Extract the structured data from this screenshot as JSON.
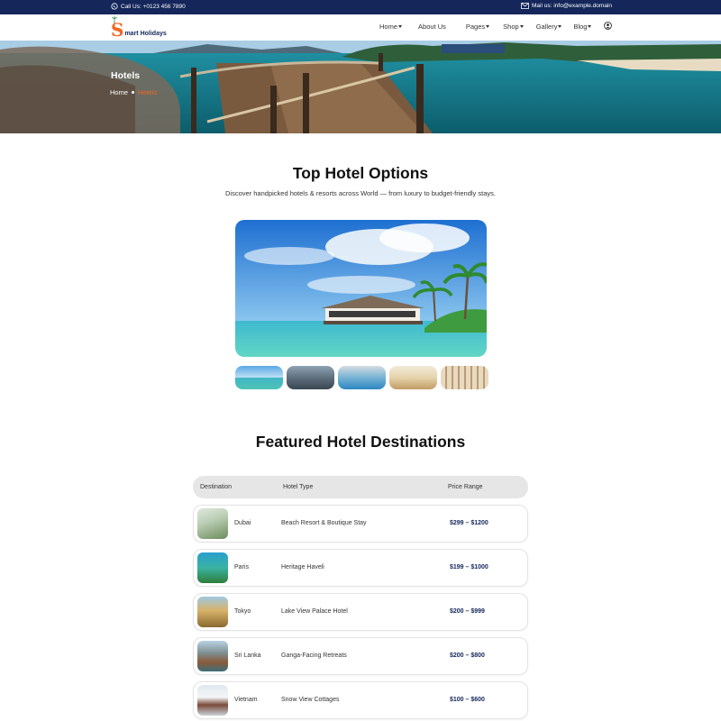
{
  "topbar": {
    "call": "Call Us: +0123 456 7890",
    "mail": "Mail us: info@example.domain"
  },
  "brand": {
    "logo_letter": "S",
    "logo_text": "mart Holidays",
    "accent": "#f26722",
    "navy": "#14265a"
  },
  "nav": [
    {
      "label": "Home",
      "dropdown": true
    },
    {
      "label": "About Us",
      "dropdown": false
    },
    {
      "label": "Pages",
      "dropdown": true
    },
    {
      "label": "Shop",
      "dropdown": true
    },
    {
      "label": "Gallery",
      "dropdown": true
    },
    {
      "label": "Blog",
      "dropdown": true
    }
  ],
  "hero": {
    "title": "Hotels",
    "breadcrumb_home": "Home",
    "breadcrumb_current": "Hotels"
  },
  "section1": {
    "title": "Top Hotel Options",
    "subtitle": "Discover handpicked hotels & resorts across World — from luxury to budget-friendly stays."
  },
  "section2": {
    "title": "Featured Hotel Destinations"
  },
  "table": {
    "headers": {
      "destination": "Destination",
      "type": "Hotel Type",
      "price": "Price Range"
    },
    "rows": [
      {
        "destination": "Dubai",
        "type": "Beach Resort & Boutique Stay",
        "price": "$299 – $1200"
      },
      {
        "destination": "Paris",
        "type": "Heritage Haveli",
        "price": "$199 – $1000"
      },
      {
        "destination": "Tokyo",
        "type": "Lake View Palace Hotel",
        "price": "$200 – $999"
      },
      {
        "destination": "Sri Lanka",
        "type": "Ganga-Facing Retreats",
        "price": "$200 – $800"
      },
      {
        "destination": "Vietnam",
        "type": "Snow View Cottages",
        "price": "$100 – $600"
      }
    ]
  }
}
